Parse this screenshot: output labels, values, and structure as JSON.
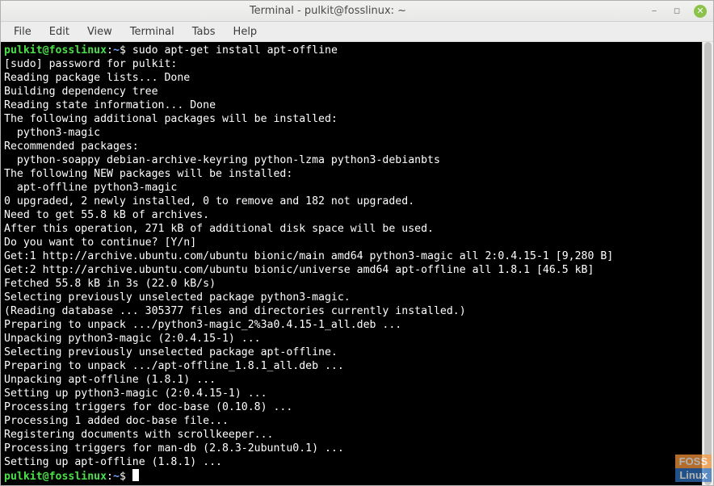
{
  "window": {
    "title": "Terminal - pulkit@fosslinux: ~"
  },
  "menubar": {
    "file": "File",
    "edit": "Edit",
    "view": "View",
    "terminal": "Terminal",
    "tabs": "Tabs",
    "help": "Help"
  },
  "prompt": {
    "user_host": "pulkit@fosslinux",
    "colon": ":",
    "path": "~",
    "dollar": "$ "
  },
  "command": "sudo apt-get install apt-offline",
  "output_lines": [
    "[sudo] password for pulkit: ",
    "Reading package lists... Done",
    "Building dependency tree       ",
    "Reading state information... Done",
    "The following additional packages will be installed:",
    "  python3-magic",
    "Recommended packages:",
    "  python-soappy debian-archive-keyring python-lzma python3-debianbts",
    "The following NEW packages will be installed:",
    "  apt-offline python3-magic",
    "0 upgraded, 2 newly installed, 0 to remove and 182 not upgraded.",
    "Need to get 55.8 kB of archives.",
    "After this operation, 271 kB of additional disk space will be used.",
    "Do you want to continue? [Y/n] ",
    "Get:1 http://archive.ubuntu.com/ubuntu bionic/main amd64 python3-magic all 2:0.4.15-1 [9,280 B]",
    "Get:2 http://archive.ubuntu.com/ubuntu bionic/universe amd64 apt-offline all 1.8.1 [46.5 kB]",
    "Fetched 55.8 kB in 3s (22.0 kB/s)",
    "Selecting previously unselected package python3-magic.",
    "(Reading database ... 305377 files and directories currently installed.)",
    "Preparing to unpack .../python3-magic_2%3a0.4.15-1_all.deb ...",
    "Unpacking python3-magic (2:0.4.15-1) ...",
    "Selecting previously unselected package apt-offline.",
    "Preparing to unpack .../apt-offline_1.8.1_all.deb ...",
    "Unpacking apt-offline (1.8.1) ...",
    "Setting up python3-magic (2:0.4.15-1) ...",
    "Processing triggers for doc-base (0.10.8) ...",
    "Processing 1 added doc-base file...",
    "Registering documents with scrollkeeper...",
    "Processing triggers for man-db (2.8.3-2ubuntu0.1) ...",
    "Setting up apt-offline (1.8.1) ..."
  ],
  "watermark": {
    "top": "FOSS",
    "bottom": "Linux"
  }
}
